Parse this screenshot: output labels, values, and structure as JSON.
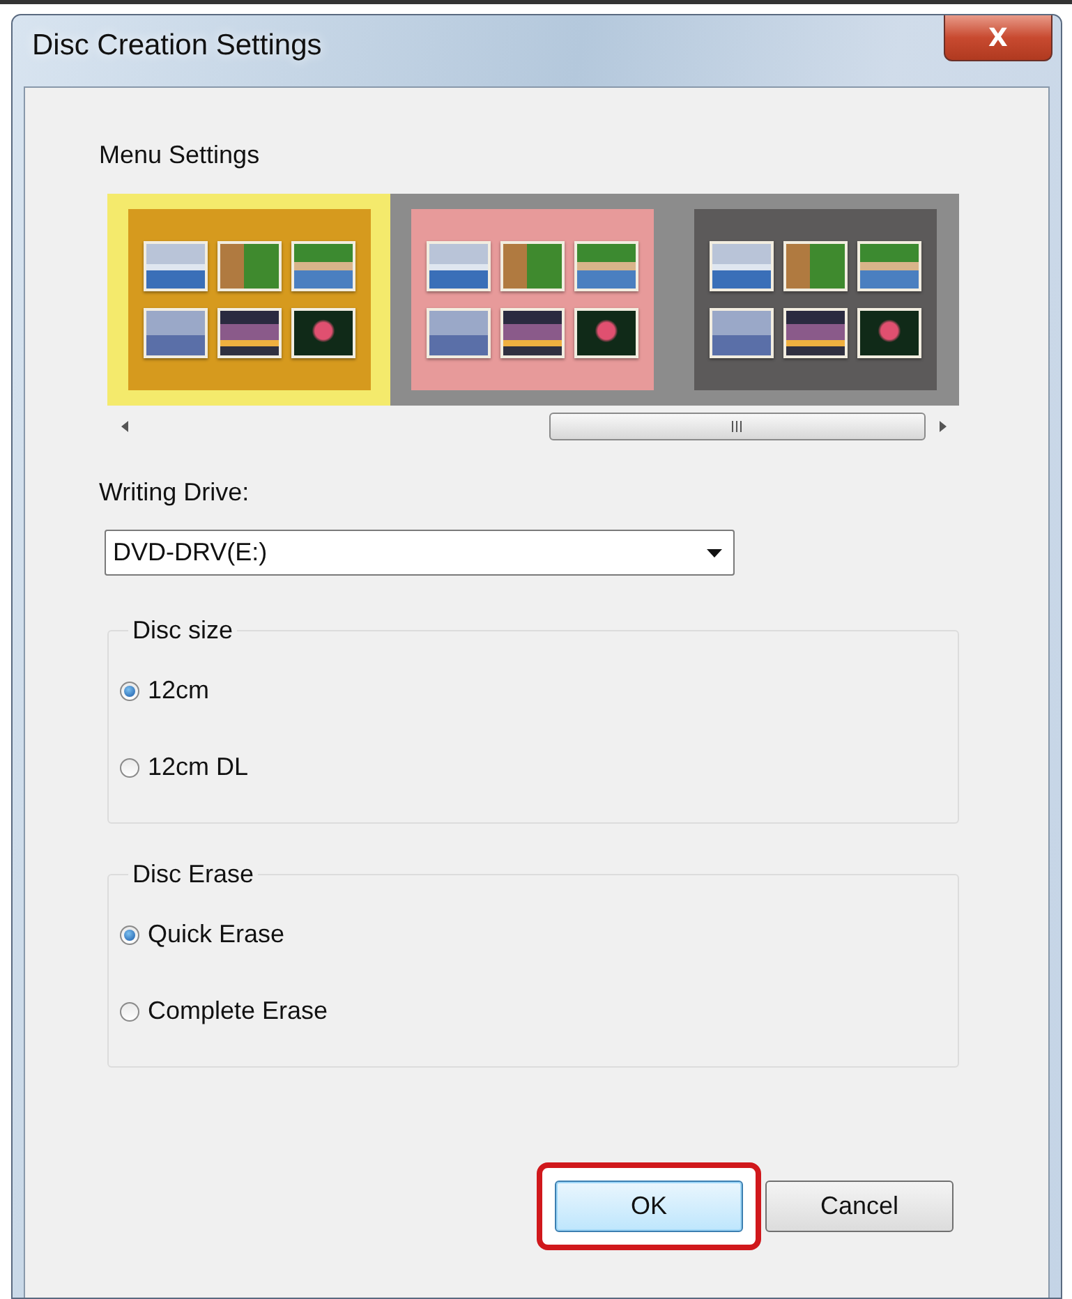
{
  "window": {
    "title": "Disc Creation Settings",
    "close_label": "X"
  },
  "menu_settings": {
    "label": "Menu Settings",
    "themes": [
      {
        "color": "#d69a1e",
        "selected": true
      },
      {
        "color": "#e79a9a",
        "selected": false
      },
      {
        "color": "#5c5a5a",
        "selected": false
      }
    ]
  },
  "writing_drive": {
    "label": "Writing Drive:",
    "value": "DVD-DRV(E:)"
  },
  "groups": [
    {
      "title": "Disc size",
      "options": [
        {
          "label": "12cm",
          "selected": true
        },
        {
          "label": "12cm DL",
          "selected": false
        }
      ]
    },
    {
      "title": "Disc Erase",
      "options": [
        {
          "label": "Quick Erase",
          "selected": true
        },
        {
          "label": "Complete Erase",
          "selected": false
        }
      ]
    }
  ],
  "buttons": [
    {
      "label": "OK",
      "default": true,
      "highlighted": true
    },
    {
      "label": "Cancel",
      "default": false,
      "highlighted": false
    }
  ]
}
